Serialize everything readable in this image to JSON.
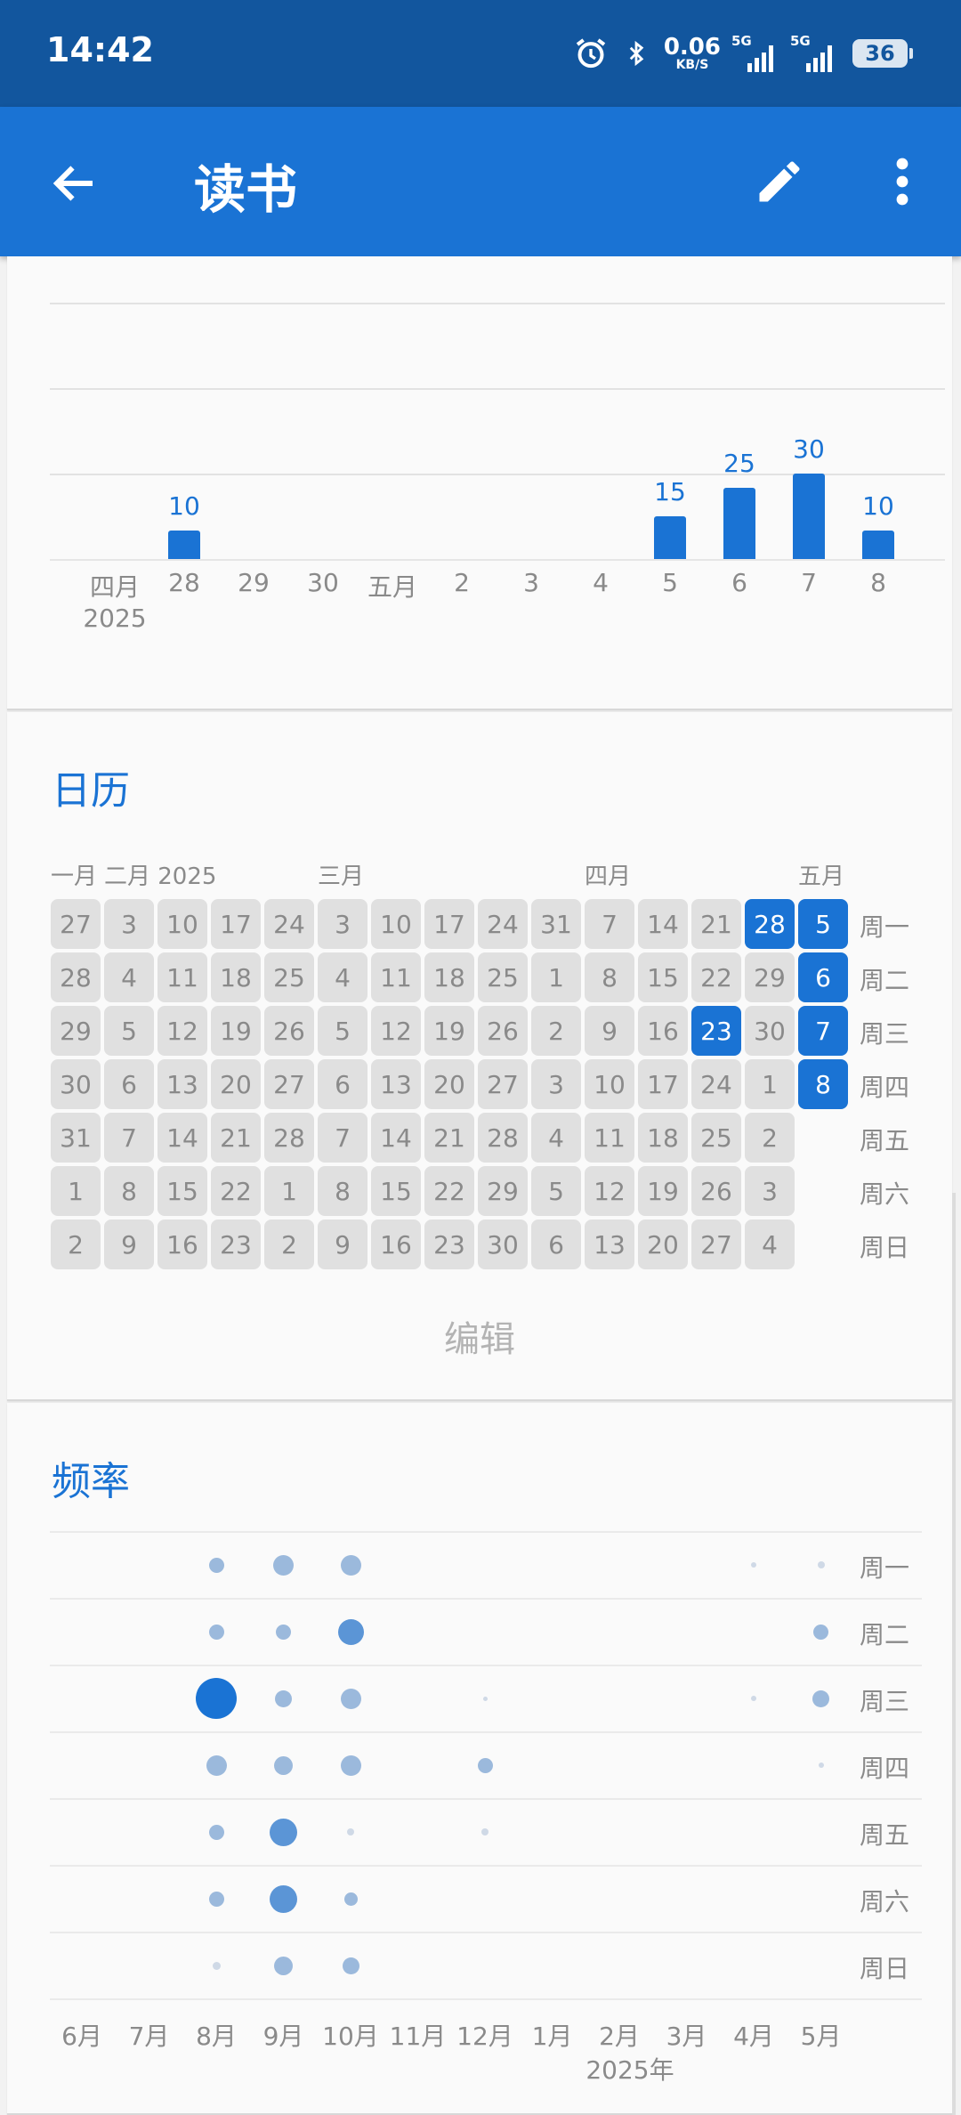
{
  "status_bar": {
    "time": "14:42",
    "net_speed": "0.06",
    "net_unit": "KB/S",
    "signal1_label": "5G",
    "signal2_label": "5G",
    "battery": "36",
    "icons": [
      "alarm-icon",
      "bluetooth-icon",
      "signal-icon",
      "battery-icon"
    ]
  },
  "app_bar": {
    "title": "读书",
    "icons": [
      "back-arrow-icon",
      "pencil-icon",
      "more-vert-icon"
    ]
  },
  "colors": {
    "primary": "#1a73d4",
    "status_bar": "#12569e",
    "inactive_cell": "#e0e0e0"
  },
  "chart_data": {
    "type": "bar",
    "categories": [
      "四月",
      "28",
      "29",
      "30",
      "五月",
      "2",
      "3",
      "4",
      "5",
      "6",
      "7",
      "8"
    ],
    "year_label": "2025",
    "values": [
      null,
      10,
      null,
      null,
      null,
      null,
      null,
      null,
      15,
      25,
      30,
      10
    ],
    "data_labels": [
      "",
      "10",
      "",
      "",
      "",
      "",
      "",
      "",
      "15",
      "25",
      "30",
      "10"
    ],
    "title": "",
    "xlabel": "",
    "ylabel": "",
    "grid": true
  },
  "calendar": {
    "title": "日历",
    "months": [
      "一月",
      "二月 2025",
      "三月",
      "四月",
      "五月"
    ],
    "weekdays": [
      "周一",
      "周二",
      "周三",
      "周四",
      "周五",
      "周六",
      "周日"
    ],
    "columns": [
      {
        "days": [
          "27",
          "28",
          "29",
          "30",
          "31",
          "1",
          "2"
        ],
        "active": []
      },
      {
        "days": [
          "3",
          "4",
          "5",
          "6",
          "7",
          "8",
          "9"
        ],
        "active": []
      },
      {
        "days": [
          "10",
          "11",
          "12",
          "13",
          "14",
          "15",
          "16"
        ],
        "active": []
      },
      {
        "days": [
          "17",
          "18",
          "19",
          "20",
          "21",
          "22",
          "23"
        ],
        "active": []
      },
      {
        "days": [
          "24",
          "25",
          "26",
          "27",
          "28",
          "1",
          "2"
        ],
        "active": []
      },
      {
        "days": [
          "3",
          "4",
          "5",
          "6",
          "7",
          "8",
          "9"
        ],
        "active": []
      },
      {
        "days": [
          "10",
          "11",
          "12",
          "13",
          "14",
          "15",
          "16"
        ],
        "active": []
      },
      {
        "days": [
          "17",
          "18",
          "19",
          "20",
          "21",
          "22",
          "23"
        ],
        "active": []
      },
      {
        "days": [
          "24",
          "25",
          "26",
          "27",
          "28",
          "29",
          "30"
        ],
        "active": []
      },
      {
        "days": [
          "31",
          "1",
          "2",
          "3",
          "4",
          "5",
          "6"
        ],
        "active": []
      },
      {
        "days": [
          "7",
          "8",
          "9",
          "10",
          "11",
          "12",
          "13"
        ],
        "active": []
      },
      {
        "days": [
          "14",
          "15",
          "16",
          "17",
          "18",
          "19",
          "20"
        ],
        "active": []
      },
      {
        "days": [
          "21",
          "22",
          "23",
          "24",
          "25",
          "26",
          "27"
        ],
        "active": [
          2
        ]
      },
      {
        "days": [
          "28",
          "29",
          "30",
          "1",
          "2",
          "3",
          "4"
        ],
        "active": [
          0
        ]
      },
      {
        "days": [
          "5",
          "6",
          "7",
          "8"
        ],
        "active": [
          0,
          1,
          2,
          3
        ]
      }
    ],
    "edit_label": "编辑"
  },
  "frequency": {
    "title": "频率",
    "weekdays": [
      "周一",
      "周二",
      "周三",
      "周四",
      "周五",
      "周六",
      "周日"
    ],
    "months": [
      "6月",
      "7月",
      "8月",
      "9月",
      "10月",
      "11月",
      "12月",
      "1月",
      "2月",
      "3月",
      "4月",
      "5月"
    ],
    "year_label": "2025年",
    "dot_intensity": [
      [
        0,
        0,
        0.3,
        0.45,
        0.45,
        0,
        0,
        0,
        0,
        0,
        0.05,
        0.1
      ],
      [
        0,
        0,
        0.3,
        0.3,
        0.6,
        0,
        0,
        0,
        0,
        0,
        0,
        0.3
      ],
      [
        0,
        0,
        1.0,
        0.35,
        0.45,
        0,
        0.03,
        0,
        0,
        0,
        0.05,
        0.35
      ],
      [
        0,
        0,
        0.45,
        0.4,
        0.45,
        0,
        0.3,
        0,
        0,
        0,
        0,
        0.05
      ],
      [
        0,
        0,
        0.3,
        0.65,
        0.1,
        0,
        0.1,
        0,
        0,
        0,
        0,
        0
      ],
      [
        0,
        0,
        0.3,
        0.65,
        0.25,
        0,
        0,
        0,
        0,
        0,
        0,
        0
      ],
      [
        0,
        0,
        0.12,
        0.4,
        0.35,
        0,
        0,
        0,
        0,
        0,
        0,
        0
      ]
    ]
  }
}
